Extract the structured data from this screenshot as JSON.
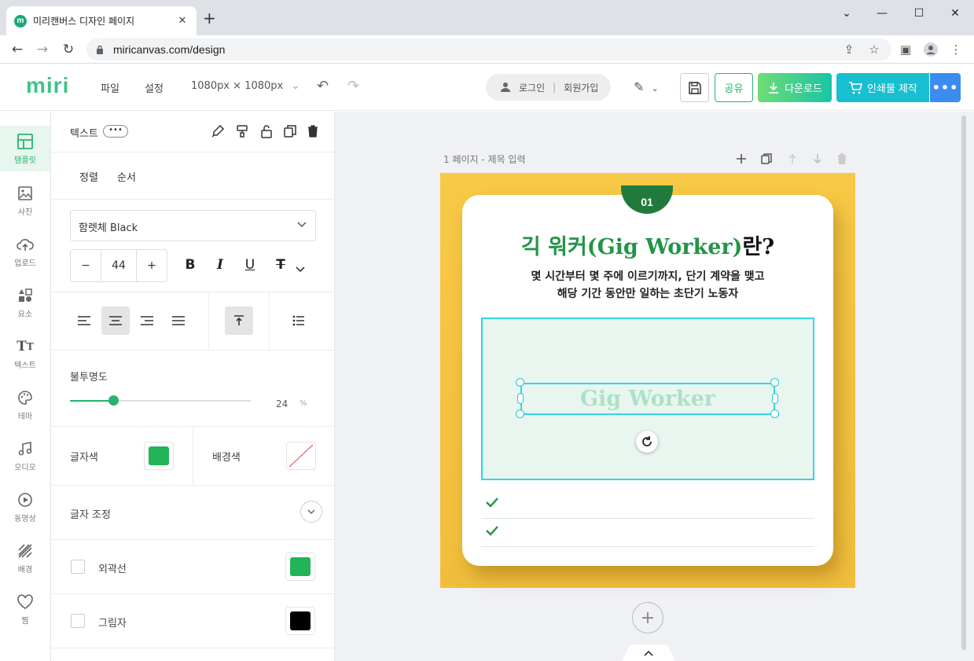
{
  "browser": {
    "tab_title": "미리캔버스 디자인 페이지",
    "favicon_letter": "m",
    "url": "miricanvas.com/design"
  },
  "header": {
    "logo": "miri",
    "menu": [
      "파일",
      "설정"
    ],
    "canvas_size": "1080px × 1080px",
    "login": "로그인",
    "signup": "회원가입",
    "share": "공유",
    "download": "다운로드",
    "print": "인쇄물 제작"
  },
  "sidebar": {
    "items": [
      {
        "label": "템플릿",
        "icon": "template-icon"
      },
      {
        "label": "사진",
        "icon": "photo-icon"
      },
      {
        "label": "업로드",
        "icon": "upload-icon"
      },
      {
        "label": "요소",
        "icon": "elements-icon"
      },
      {
        "label": "텍스트",
        "icon": "text-icon"
      },
      {
        "label": "테마",
        "icon": "palette-icon"
      },
      {
        "label": "오디오",
        "icon": "music-icon"
      },
      {
        "label": "동영상",
        "icon": "play-icon"
      },
      {
        "label": "배경",
        "icon": "background-icon"
      },
      {
        "label": "찜",
        "icon": "heart-icon"
      }
    ],
    "active_index": 0
  },
  "panel": {
    "title": "텍스트",
    "more": "•••",
    "tabs": [
      "정렬",
      "순서"
    ],
    "font": "함렛체 Black",
    "size": "44",
    "opacity_label": "불투명도",
    "opacity_value": "24",
    "opacity_fraction": 0.24,
    "opacity_unit": "%",
    "text_color_label": "글자색",
    "text_color": "#23b45a",
    "bg_color_label": "배경색",
    "adjust_label": "글자 조정",
    "outline_label": "외곽선",
    "outline_color": "#23b45a",
    "shadow_label": "그림자",
    "shadow_color": "#000000"
  },
  "canvas": {
    "page_label": "1 페이지 - 제목 입력",
    "badge": "01",
    "headline_green": "긱 워커(Gig Worker)",
    "headline_black": "란?",
    "sub_line1": "몇 시간부터 몇 주에 이르기까지, 단기 계약을 맺고",
    "sub_line2": "해당 기간 동안만 일하는 초단기 노동자",
    "selected_text": "Gig Worker",
    "page_bg": "#f5c341",
    "accent": "#239448"
  }
}
